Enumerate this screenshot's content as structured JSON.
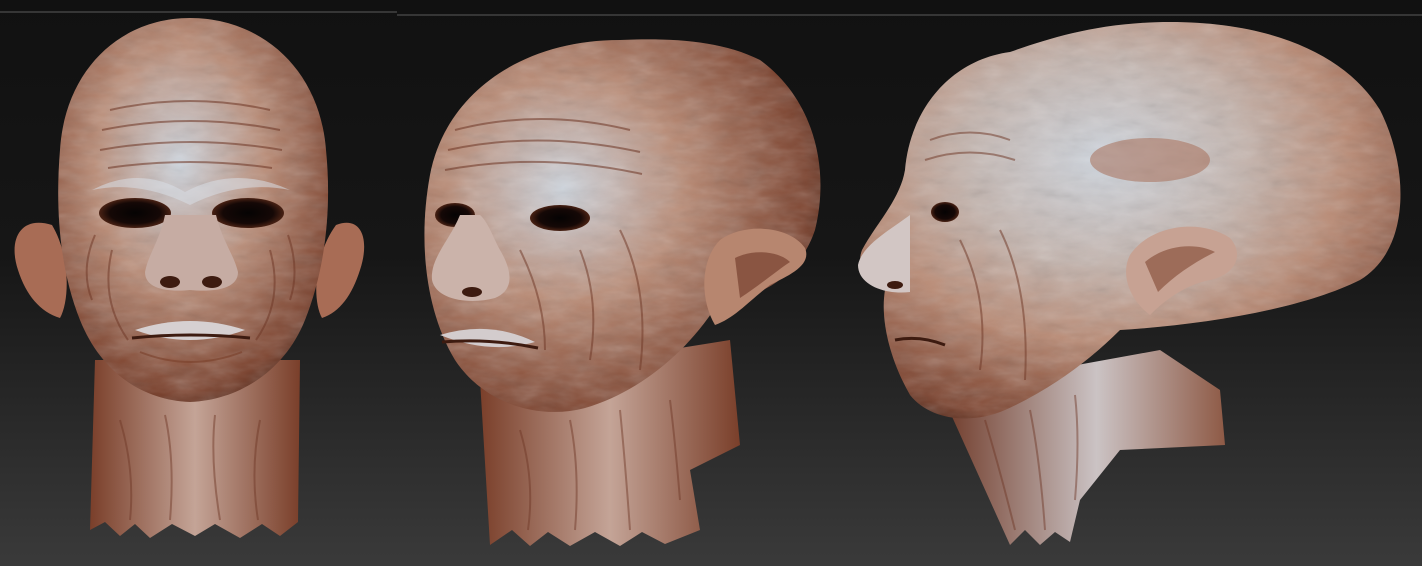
{
  "render": {
    "background_top": "#111111",
    "background_bottom": "#3a3a3a",
    "skin_light": "#cfd6df",
    "skin_mid": "#b98a74",
    "skin_dark": "#7a3f2a",
    "skin_shadow": "#3d1b10",
    "rim_light": "#aeb8c4"
  },
  "views": [
    {
      "id": "front",
      "caption": ""
    },
    {
      "id": "three-quarter",
      "caption": ""
    },
    {
      "id": "profile",
      "caption": ""
    }
  ]
}
